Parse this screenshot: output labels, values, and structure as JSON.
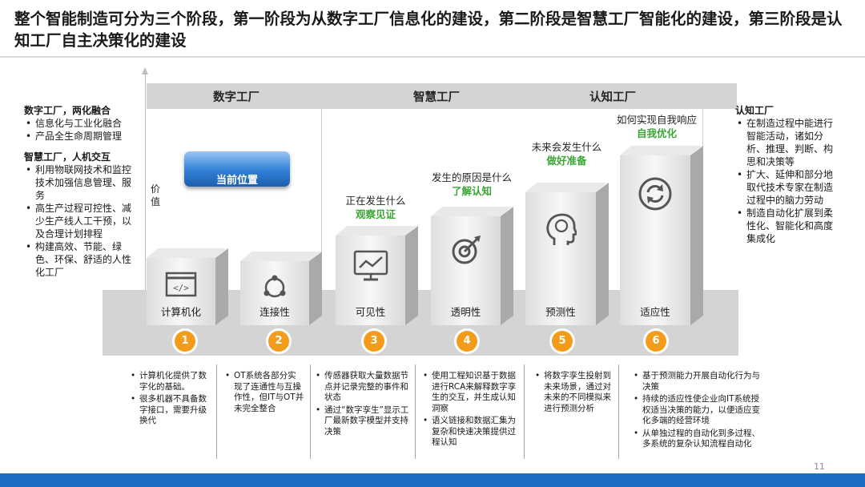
{
  "title": "整个智能制造可分为三个阶段，第一阶段为从数字工厂信息化的建设，第二阶段是智慧工厂智能化的建设，第三阶段是认知工厂自主决策化的建设",
  "stages": [
    "数字工厂",
    "智慧工厂",
    "认知工厂"
  ],
  "y_axis_label": "价值",
  "current_position": "当前位置",
  "left_panel": {
    "group1_title": "数字工厂，两化融合",
    "group1_items": [
      "信息化与工业化融合",
      "产品全生命周期管理"
    ],
    "group2_title": "智慧工厂，人机交互",
    "group2_items": [
      "利用物联网技术和监控技术加强信息管理、服务",
      "高生产过程可控性、减少生产线人工干预，以及合理计划排程",
      "构建高效、节能、绿色、环保、舒适的人性化工厂"
    ]
  },
  "right_panel": {
    "title": "认知工厂",
    "items": [
      "在制造过程中能进行智能活动，诸如分析、推理、判断、构思和决策等",
      "扩大、延伸和部分地取代技术专家在制造过程中的脑力劳动",
      "制造自动化扩展到柔性化、智能化和高度集成化"
    ]
  },
  "blocks": [
    {
      "label": "计算机化",
      "num": "1",
      "icon": "code-window-icon",
      "question": "",
      "answer": ""
    },
    {
      "label": "连接性",
      "num": "2",
      "icon": "connected-nodes-icon",
      "question": "",
      "answer": ""
    },
    {
      "label": "可见性",
      "num": "3",
      "icon": "monitor-chart-icon",
      "question": "正在发生什么",
      "answer": "观察见证"
    },
    {
      "label": "透明性",
      "num": "4",
      "icon": "target-arrow-icon",
      "question": "发生的原因是什么",
      "answer": "了解认知"
    },
    {
      "label": "预测性",
      "num": "5",
      "icon": "head-brain-icon",
      "question": "未来会发生什么",
      "answer": "做好准备"
    },
    {
      "label": "适应性",
      "num": "6",
      "icon": "cycle-arrows-icon",
      "question": "如何实现自我响应",
      "answer": "自我优化"
    }
  ],
  "descriptions": [
    [
      "计算机化提供了数字化的基础。",
      "很多机器不具备数字接口，需要升级换代"
    ],
    [
      "OT系统各部分实现了连通性与互操作性，但IT与OT并未完全整合"
    ],
    [
      "传感器获取大量数据节点并记录完整的事件和状态",
      "通过“数字孪生”显示工厂最新数字模型并支持决策"
    ],
    [
      "使用工程知识基于数据进行RCA来解释数字孪生的交互，并生成认知洞察",
      "语义链接和数据汇集为复杂和快速决策提供过程认知"
    ],
    [
      "将数字孪生投射到未来场景，通过对未来的不同模拟来进行预测分析"
    ],
    [
      "基于预测能力开展自动化行为与决策",
      "持续的适应性使企业向IT系统授权适当决策的能力，以便适应变化多端的经营环境",
      "从单独过程的自动化到多过程、多系统的复杂认知流程自动化"
    ]
  ],
  "page_number": "11",
  "colors": {
    "accent_orange": "#f39c1b",
    "answer_green": "#3aa535",
    "footer_blue": "#1f6cc4"
  }
}
